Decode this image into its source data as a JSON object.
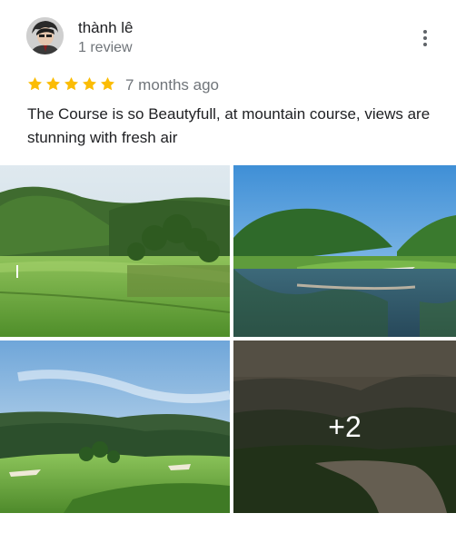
{
  "reviewer": {
    "name": "thành lê",
    "review_count": "1 review",
    "avatar_icon": "person-avatar"
  },
  "menu": {
    "icon": "more-vert-icon"
  },
  "rating": {
    "stars": 5,
    "max": 5,
    "star_color": "#fbbc04",
    "icon": "star-icon"
  },
  "review": {
    "date": "7 months ago",
    "text": "The Course is so Beautyfull, at mountain course, views are stunning with fresh air"
  },
  "photos": {
    "more_count": "+2"
  }
}
